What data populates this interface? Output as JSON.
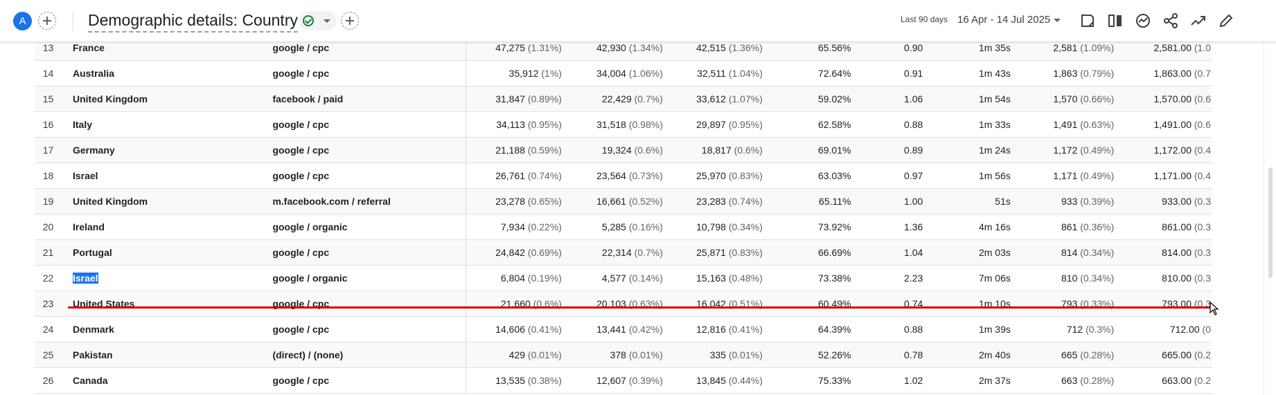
{
  "header": {
    "avatar_letter": "A",
    "title": "Demographic details: Country",
    "date_range_label": "Last 90 days",
    "date_range_value": "16 Apr - 14 Jul 2025",
    "icons": [
      "add-comparison-icon",
      "check-circle-icon",
      "caret-down-icon",
      "add-icon",
      "customize-report-icon",
      "compare-icon",
      "insights-icon",
      "share-icon",
      "trend-icon",
      "edit-icon"
    ]
  },
  "table": {
    "rows": [
      {
        "idx": "13",
        "country": "France",
        "source": "google / cpc",
        "c1": "47,275",
        "p1": "(1.31%)",
        "c2": "42,930",
        "p2": "(1.34%)",
        "c3": "42,515",
        "p3": "(1.36%)",
        "c4": "65.56%",
        "c5": "0.90",
        "c6": "1m 35s",
        "c7": "2,581",
        "p7": "(1.09%)",
        "c8": "2,581.00",
        "p8": "(1.0"
      },
      {
        "idx": "14",
        "country": "Australia",
        "source": "google / cpc",
        "c1": "35,912",
        "p1": "(1%)",
        "c2": "34,004",
        "p2": "(1.06%)",
        "c3": "32,511",
        "p3": "(1.04%)",
        "c4": "72.64%",
        "c5": "0.91",
        "c6": "1m 43s",
        "c7": "1,863",
        "p7": "(0.79%)",
        "c8": "1,863.00",
        "p8": "(0.7"
      },
      {
        "idx": "15",
        "country": "United Kingdom",
        "source": "facebook / paid",
        "c1": "31,847",
        "p1": "(0.89%)",
        "c2": "22,429",
        "p2": "(0.7%)",
        "c3": "33,612",
        "p3": "(1.07%)",
        "c4": "59.02%",
        "c5": "1.06",
        "c6": "1m 54s",
        "c7": "1,570",
        "p7": "(0.66%)",
        "c8": "1,570.00",
        "p8": "(0.6"
      },
      {
        "idx": "16",
        "country": "Italy",
        "source": "google / cpc",
        "c1": "34,113",
        "p1": "(0.95%)",
        "c2": "31,518",
        "p2": "(0.98%)",
        "c3": "29,897",
        "p3": "(0.95%)",
        "c4": "62.58%",
        "c5": "0.88",
        "c6": "1m 33s",
        "c7": "1,491",
        "p7": "(0.63%)",
        "c8": "1,491.00",
        "p8": "(0.6"
      },
      {
        "idx": "17",
        "country": "Germany",
        "source": "google / cpc",
        "c1": "21,188",
        "p1": "(0.59%)",
        "c2": "19,324",
        "p2": "(0.6%)",
        "c3": "18,817",
        "p3": "(0.6%)",
        "c4": "69.01%",
        "c5": "0.89",
        "c6": "1m 24s",
        "c7": "1,172",
        "p7": "(0.49%)",
        "c8": "1,172.00",
        "p8": "(0.4"
      },
      {
        "idx": "18",
        "country": "Israel",
        "source": "google / cpc",
        "c1": "26,761",
        "p1": "(0.74%)",
        "c2": "23,564",
        "p2": "(0.73%)",
        "c3": "25,970",
        "p3": "(0.83%)",
        "c4": "63.03%",
        "c5": "0.97",
        "c6": "1m 56s",
        "c7": "1,171",
        "p7": "(0.49%)",
        "c8": "1,171.00",
        "p8": "(0.4"
      },
      {
        "idx": "19",
        "country": "United Kingdom",
        "source": "m.facebook.com / referral",
        "c1": "23,278",
        "p1": "(0.65%)",
        "c2": "16,661",
        "p2": "(0.52%)",
        "c3": "23,283",
        "p3": "(0.74%)",
        "c4": "65.11%",
        "c5": "1.00",
        "c6": "51s",
        "c7": "933",
        "p7": "(0.39%)",
        "c8": "933.00",
        "p8": "(0.3"
      },
      {
        "idx": "20",
        "country": "Ireland",
        "source": "google / organic",
        "c1": "7,934",
        "p1": "(0.22%)",
        "c2": "5,285",
        "p2": "(0.16%)",
        "c3": "10,798",
        "p3": "(0.34%)",
        "c4": "73.92%",
        "c5": "1.36",
        "c6": "4m 16s",
        "c7": "861",
        "p7": "(0.36%)",
        "c8": "861.00",
        "p8": "(0.3"
      },
      {
        "idx": "21",
        "country": "Portugal",
        "source": "google / cpc",
        "c1": "24,842",
        "p1": "(0.69%)",
        "c2": "22,314",
        "p2": "(0.7%)",
        "c3": "25,871",
        "p3": "(0.83%)",
        "c4": "66.69%",
        "c5": "1.04",
        "c6": "2m 03s",
        "c7": "814",
        "p7": "(0.34%)",
        "c8": "814.00",
        "p8": "(0.3"
      },
      {
        "idx": "22",
        "country": "Israel",
        "source": "google / organic",
        "c1": "6,804",
        "p1": "(0.19%)",
        "c2": "4,577",
        "p2": "(0.14%)",
        "c3": "15,163",
        "p3": "(0.48%)",
        "c4": "73.38%",
        "c5": "2.23",
        "c6": "7m 06s",
        "c7": "810",
        "p7": "(0.34%)",
        "c8": "810.00",
        "p8": "(0.3"
      },
      {
        "idx": "23",
        "country": "United States",
        "source": "google / cpc",
        "c1": "21,660",
        "p1": "(0.6%)",
        "c2": "20,103",
        "p2": "(0.63%)",
        "c3": "16,042",
        "p3": "(0.51%)",
        "c4": "60.49%",
        "c5": "0.74",
        "c6": "1m 10s",
        "c7": "793",
        "p7": "(0.33%)",
        "c8": "793.00",
        "p8": "(0.3"
      },
      {
        "idx": "24",
        "country": "Denmark",
        "source": "google / cpc",
        "c1": "14,606",
        "p1": "(0.41%)",
        "c2": "13,441",
        "p2": "(0.42%)",
        "c3": "12,816",
        "p3": "(0.41%)",
        "c4": "64.39%",
        "c5": "0.88",
        "c6": "1m 39s",
        "c7": "712",
        "p7": "(0.3%)",
        "c8": "712.00",
        "p8": "(0"
      },
      {
        "idx": "25",
        "country": "Pakistan",
        "source": "(direct) / (none)",
        "c1": "429",
        "p1": "(0.01%)",
        "c2": "378",
        "p2": "(0.01%)",
        "c3": "335",
        "p3": "(0.01%)",
        "c4": "52.26%",
        "c5": "0.78",
        "c6": "2m 40s",
        "c7": "665",
        "p7": "(0.28%)",
        "c8": "665.00",
        "p8": "(0.2"
      },
      {
        "idx": "26",
        "country": "Canada",
        "source": "google / cpc",
        "c1": "13,535",
        "p1": "(0.38%)",
        "c2": "12,607",
        "p2": "(0.39%)",
        "c3": "13,845",
        "p3": "(0.44%)",
        "c4": "75.33%",
        "c5": "1.02",
        "c6": "2m 37s",
        "c7": "663",
        "p7": "(0.28%)",
        "c8": "663.00",
        "p8": "(0.2"
      }
    ],
    "selected_row_index": 9
  },
  "colors": {
    "accent": "#1a73e8",
    "drop_indicator": "#d50000",
    "success": "#188038"
  }
}
